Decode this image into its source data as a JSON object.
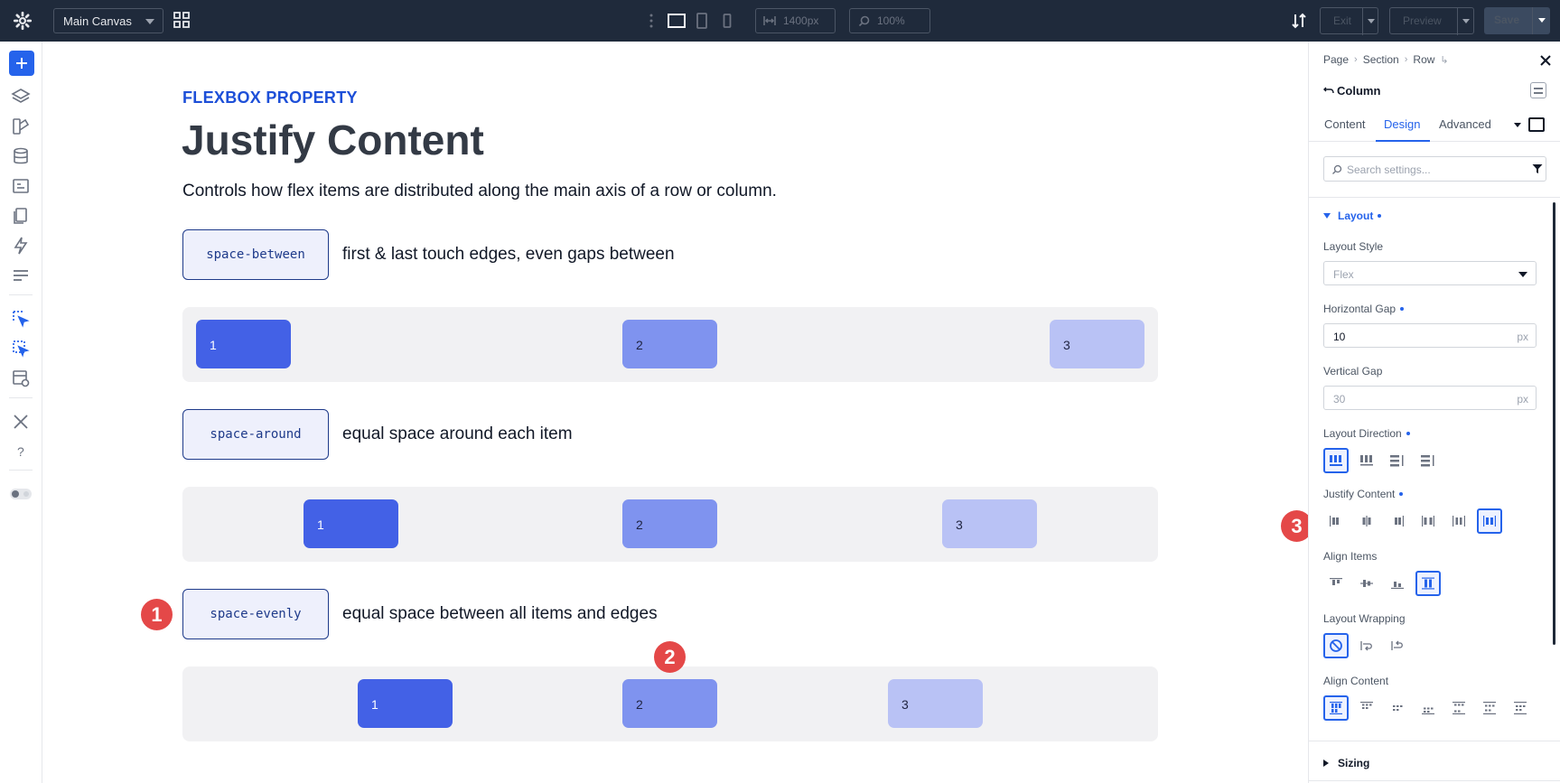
{
  "topbar": {
    "canvas_select": "Main Canvas",
    "width_value": "1400px",
    "zoom_value": "100%",
    "exit_label": "Exit",
    "preview_label": "Preview",
    "save_label": "Save"
  },
  "canvas": {
    "eyebrow": "FLEXBOX PROPERTY",
    "title": "Justify Content",
    "subtitle": "Controls how flex items are distributed along the main axis of a row or column.",
    "examples": [
      {
        "pill": "space-between",
        "desc": "first & last touch edges, even gaps between",
        "items": [
          "1",
          "2",
          "3"
        ]
      },
      {
        "pill": "space-around",
        "desc": "equal space around each item",
        "items": [
          "1",
          "2",
          "3"
        ]
      },
      {
        "pill": "space-evenly",
        "desc": "equal space between all items and edges",
        "items": [
          "1",
          "2",
          "3"
        ]
      }
    ],
    "markers": [
      "1",
      "2",
      "3"
    ]
  },
  "panel": {
    "breadcrumb": [
      "Page",
      "Section",
      "Row"
    ],
    "element_title": "Column",
    "tabs": [
      "Content",
      "Design",
      "Advanced"
    ],
    "active_tab": "Design",
    "search_placeholder": "Search settings...",
    "section_layout": "Layout",
    "layout_style_label": "Layout Style",
    "layout_style_value": "Flex",
    "horizontal_gap_label": "Horizontal Gap",
    "horizontal_gap_value": "10",
    "horizontal_gap_unit": "px",
    "vertical_gap_label": "Vertical Gap",
    "vertical_gap_placeholder": "30",
    "vertical_gap_unit": "px",
    "layout_direction_label": "Layout Direction",
    "justify_content_label": "Justify Content",
    "align_items_label": "Align Items",
    "layout_wrapping_label": "Layout Wrapping",
    "align_content_label": "Align Content",
    "section_sizing": "Sizing"
  },
  "colors": {
    "accent": "#2563eb",
    "topbar": "#1f2a3b",
    "item1": "#4361e6",
    "item2": "#7f93ef",
    "item3": "#b9c2f5",
    "marker": "#e44848"
  }
}
